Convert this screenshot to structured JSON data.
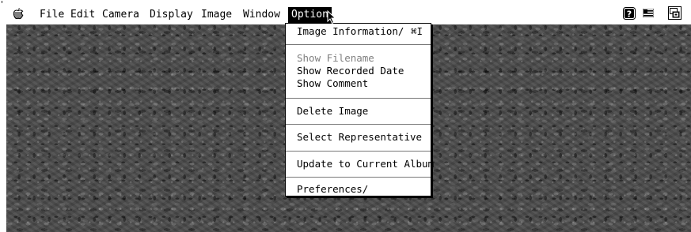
{
  "menubar": {
    "corner_mark": "'",
    "menus": [
      {
        "label": "File"
      },
      {
        "label": "Edit"
      },
      {
        "label": "Camera"
      },
      {
        "label": "Display"
      },
      {
        "label": "Image"
      },
      {
        "label": "Window"
      },
      {
        "label": "Option"
      }
    ],
    "active_menu": "Option",
    "right_icons": [
      "help-icon",
      "flag-icon",
      "application-icon"
    ]
  },
  "option_menu": {
    "item_info": "Image Information/",
    "item_info_shortcut": "⌘I",
    "item_filename": "Show Filename",
    "item_recorded_date": "Show Recorded Date",
    "item_comment": "Show Comment",
    "item_delete": "Delete Image",
    "item_representative": "Select Representative",
    "item_update_album": "Update to Current Album",
    "item_preferences": "Preferences/",
    "disabled_items": [
      "Show Filename"
    ]
  },
  "colors": {
    "menu_highlight": "#000000",
    "desktop": "#4a4a4a",
    "disabled_text": "#808080"
  }
}
